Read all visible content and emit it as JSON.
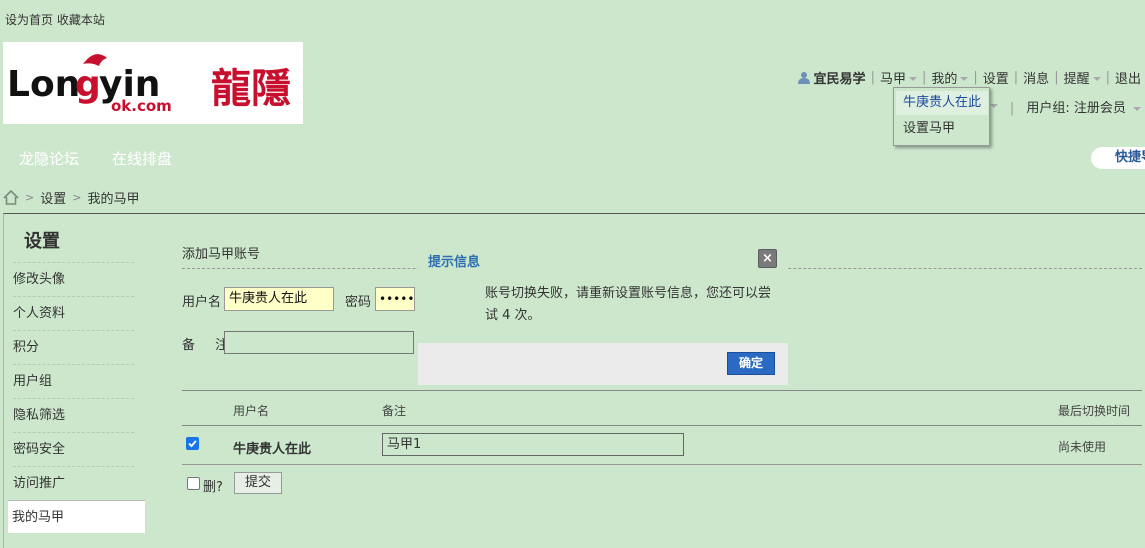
{
  "topbar": {
    "set_home": "设为首页",
    "bookmark": "收藏本站"
  },
  "logo": {
    "brand_text": "Longyin",
    "sub_text": "ok.com",
    "cn_text": "龍隱"
  },
  "user_nav": {
    "username": "宜民易学",
    "items": [
      "马甲",
      "我的",
      "设置",
      "消息",
      "提醒",
      "退出"
    ]
  },
  "user_group": {
    "label": "用户组: 注册会员"
  },
  "dropdown": {
    "items": [
      "牛庚贵人在此",
      "设置马甲"
    ]
  },
  "main_nav": {
    "items": [
      "龙隐论坛",
      "在线排盘"
    ],
    "quick_nav": "快捷导航"
  },
  "breadcrumb": {
    "items": [
      "设置",
      "我的马甲"
    ]
  },
  "sidebar": {
    "title": "设置",
    "items": [
      "修改头像",
      "个人资料",
      "积分",
      "用户组",
      "隐私筛选",
      "密码安全",
      "访问推广",
      "我的马甲"
    ]
  },
  "form": {
    "title": "添加马甲账号",
    "username_label": "用户名",
    "username_value": "牛庚贵人在此",
    "password_label": "密码",
    "password_value": "•••••",
    "note_label": "备 注",
    "note_value": ""
  },
  "table": {
    "headers": {
      "username": "用户名",
      "note": "备注",
      "last_switch": "最后切换时间"
    },
    "rows": [
      {
        "username": "牛庚贵人在此",
        "note": "马甲1",
        "last_switch": "尚未使用",
        "checked": true
      }
    ]
  },
  "footer": {
    "delete_label": "删?",
    "submit_label": "提交"
  },
  "dialog": {
    "title": "提示信息",
    "message": "账号切换失败，请重新设置账号信息，您还可以尝试 4 次。",
    "ok_label": "确定",
    "close_symbol": "×"
  },
  "colors": {
    "background": "#cde7cd",
    "accent": "#2a6ac2",
    "link_active": "#1b4a9c",
    "input_highlight": "#ffffc8"
  }
}
